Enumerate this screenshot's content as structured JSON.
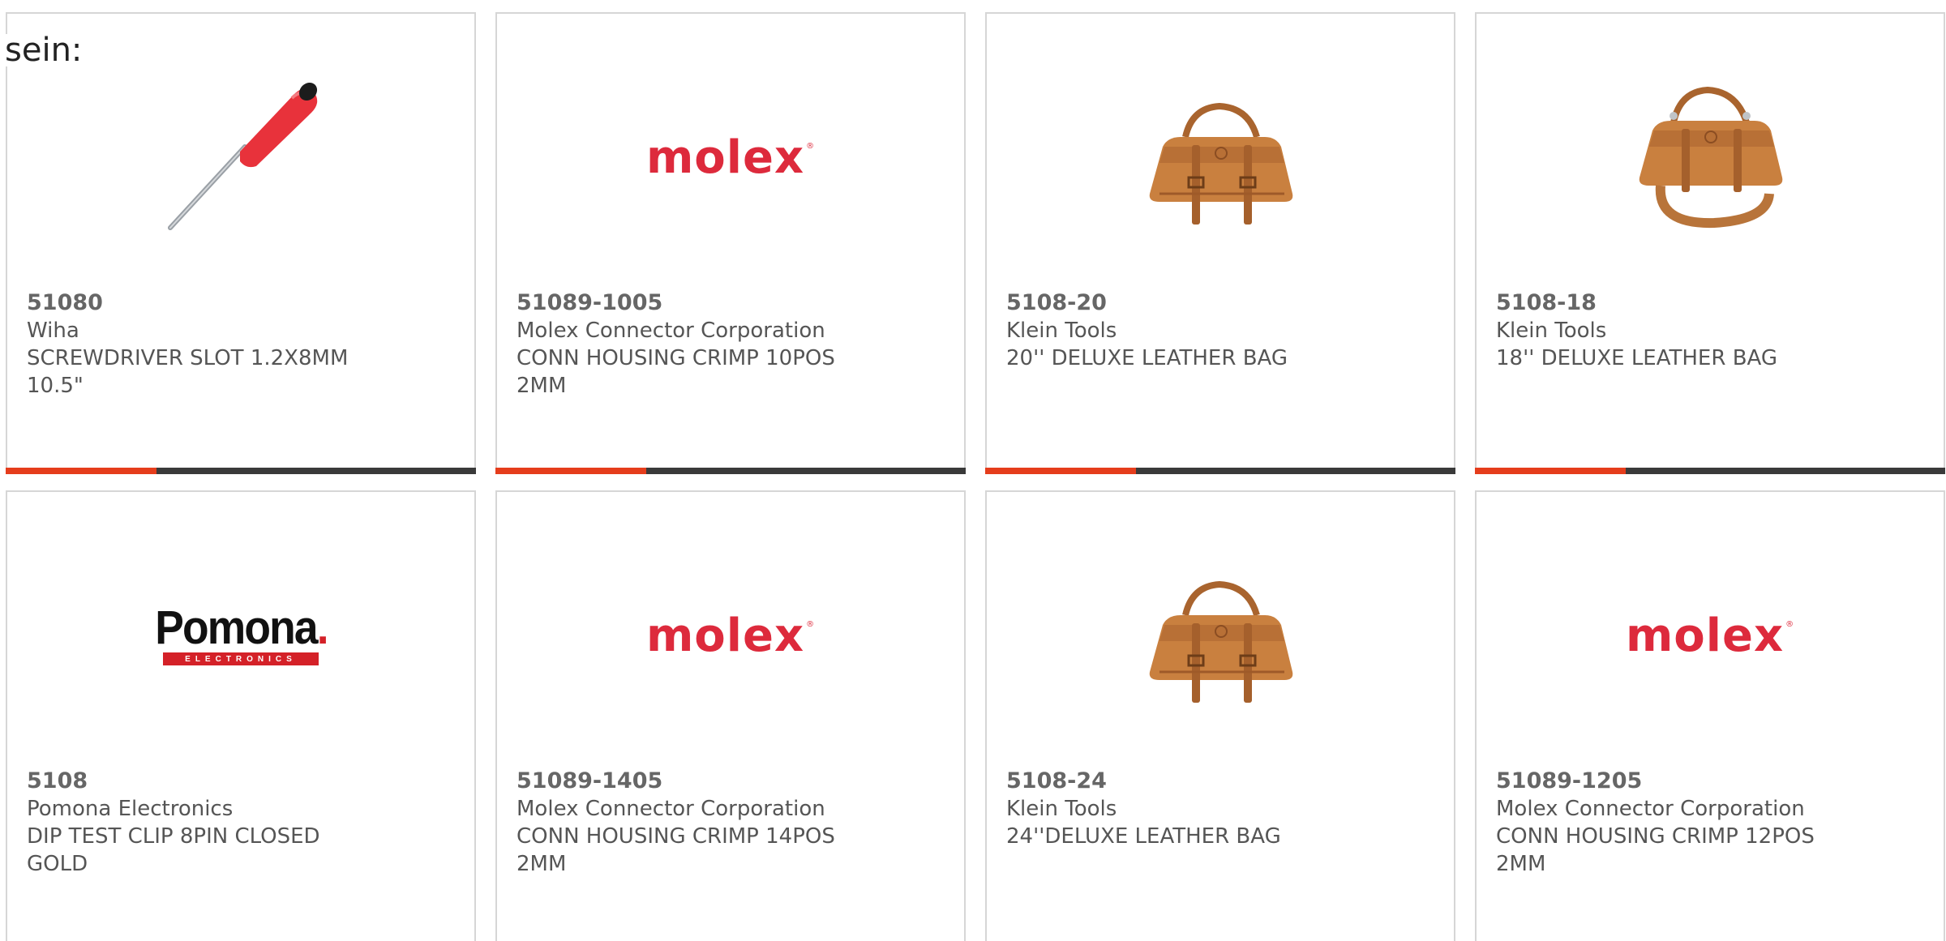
{
  "intro_text": "sein:",
  "products": [
    {
      "part_number": "51080",
      "manufacturer": "Wiha",
      "description": "SCREWDRIVER SLOT 1.2X8MM 10.5\"",
      "image": "screwdriver-image",
      "progress_fraction": 0.32
    },
    {
      "part_number": "51089-1005",
      "manufacturer": "Molex Connector Corporation",
      "description": "CONN HOUSING CRIMP 10POS 2MM",
      "image": "molex-logo",
      "progress_fraction": 0.32
    },
    {
      "part_number": "5108-20",
      "manufacturer": "Klein Tools",
      "description": "20'' DELUXE LEATHER BAG",
      "image": "leather-bag-image",
      "progress_fraction": 0.32
    },
    {
      "part_number": "5108-18",
      "manufacturer": "Klein Tools",
      "description": "18'' DELUXE LEATHER BAG",
      "image": "leather-bag-strap-image",
      "progress_fraction": 0.32
    },
    {
      "part_number": "5108",
      "manufacturer": "Pomona Electronics",
      "description": "DIP TEST CLIP 8PIN CLOSED GOLD",
      "image": "pomona-logo"
    },
    {
      "part_number": "51089-1405",
      "manufacturer": "Molex Connector Corporation",
      "description": "CONN HOUSING CRIMP 14POS 2MM",
      "image": "molex-logo"
    },
    {
      "part_number": "5108-24",
      "manufacturer": "Klein Tools",
      "description": "24''DELUXE LEATHER BAG",
      "image": "leather-bag-image"
    },
    {
      "part_number": "51089-1205",
      "manufacturer": "Molex Connector Corporation",
      "description": "CONN HOUSING CRIMP 12POS 2MM",
      "image": "molex-logo"
    }
  ],
  "logos": {
    "molex": {
      "text": "molex",
      "mark": "®"
    },
    "pomona": {
      "word": "Pomona",
      "dot": ".",
      "band": "ELECTRONICS"
    }
  },
  "colors": {
    "accent": "#e53d1c",
    "track": "#3a3a3a",
    "molex_red": "#dd2a3c",
    "pomona_red": "#d42128",
    "border": "#d6d6d6",
    "text": "#555555"
  }
}
